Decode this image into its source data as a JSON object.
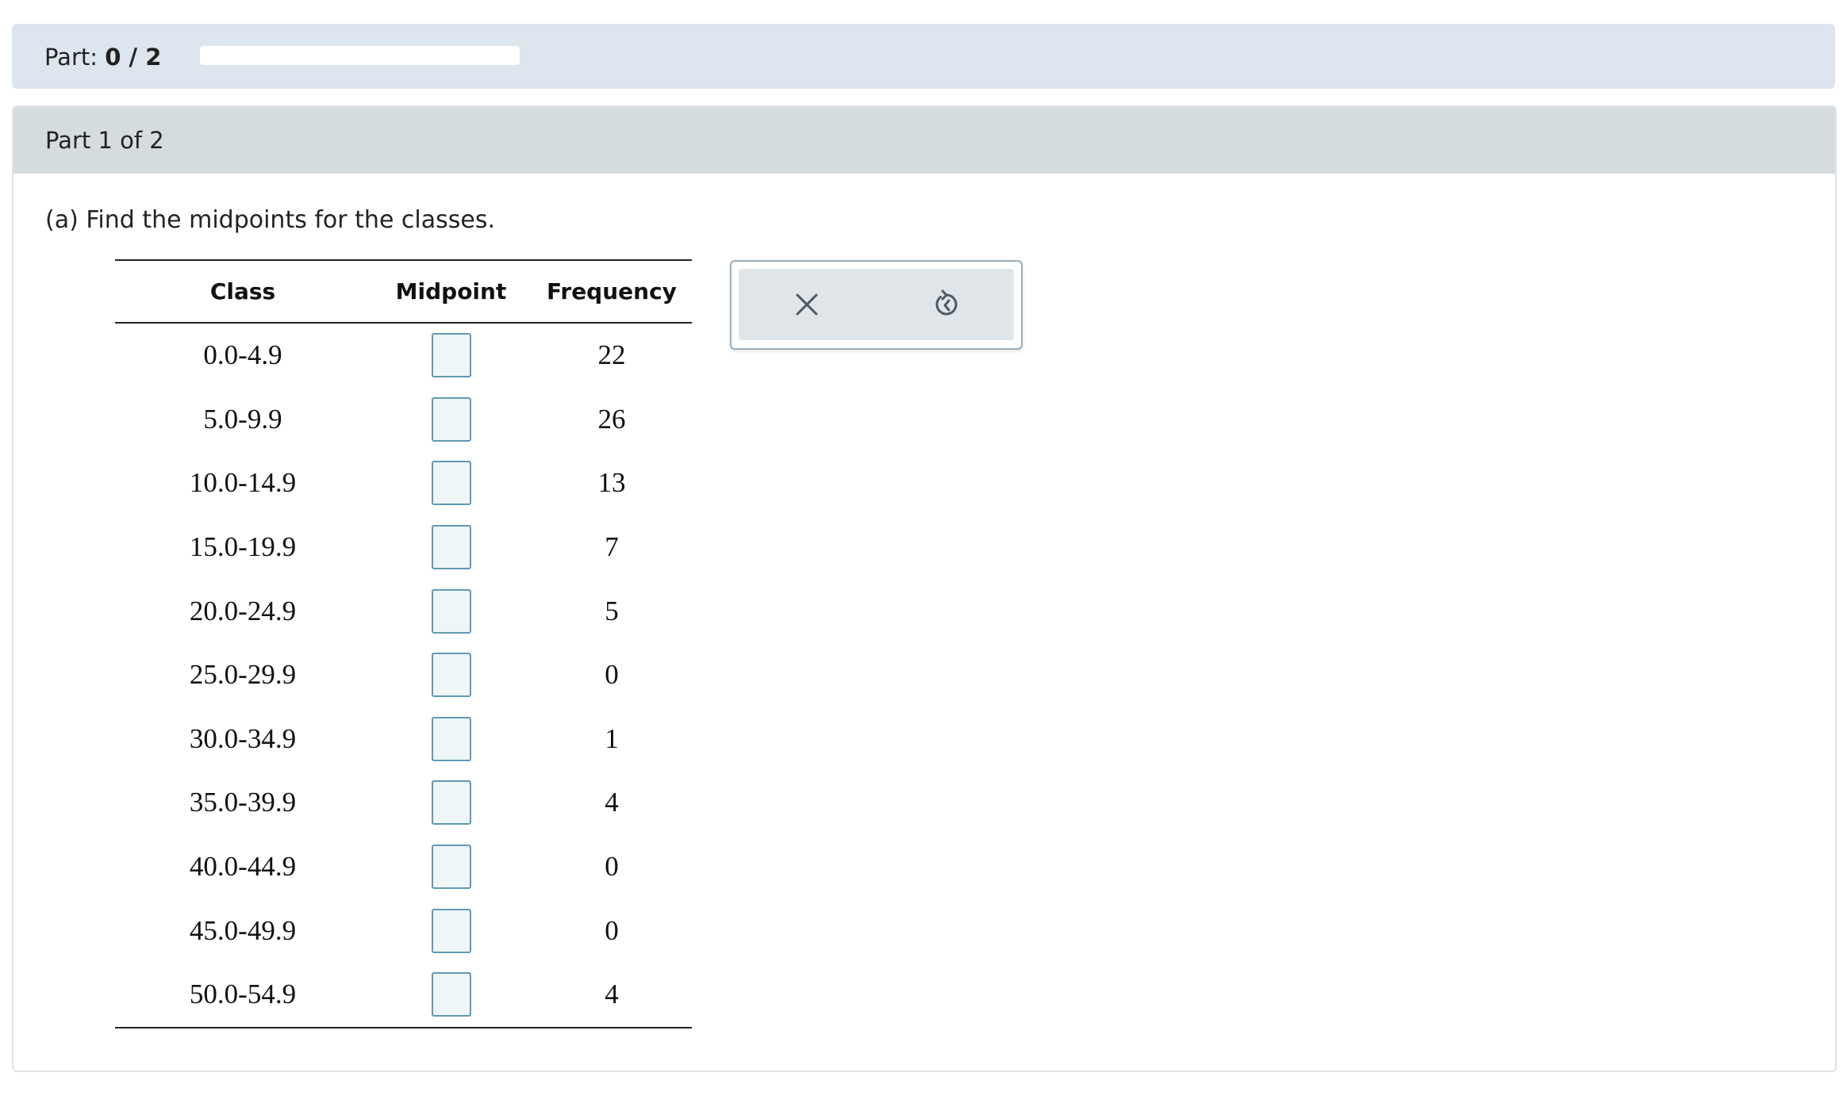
{
  "progress": {
    "label": "Part:",
    "value_text": "0 / 2",
    "fraction_complete": 0.0
  },
  "part": {
    "title": "Part 1 of 2",
    "question": "(a) Find the midpoints for the classes."
  },
  "table": {
    "headers": {
      "class": "Class",
      "midpoint": "Midpoint",
      "frequency": "Frequency"
    },
    "rows": [
      {
        "class": "0.0-4.9",
        "midpoint": "",
        "frequency": "22"
      },
      {
        "class": "5.0-9.9",
        "midpoint": "",
        "frequency": "26"
      },
      {
        "class": "10.0-14.9",
        "midpoint": "",
        "frequency": "13"
      },
      {
        "class": "15.0-19.9",
        "midpoint": "",
        "frequency": "7"
      },
      {
        "class": "20.0-24.9",
        "midpoint": "",
        "frequency": "5"
      },
      {
        "class": "25.0-29.9",
        "midpoint": "",
        "frequency": "0"
      },
      {
        "class": "30.0-34.9",
        "midpoint": "",
        "frequency": "1"
      },
      {
        "class": "35.0-39.9",
        "midpoint": "",
        "frequency": "4"
      },
      {
        "class": "40.0-44.9",
        "midpoint": "",
        "frequency": "0"
      },
      {
        "class": "45.0-49.9",
        "midpoint": "",
        "frequency": "0"
      },
      {
        "class": "50.0-54.9",
        "midpoint": "",
        "frequency": "4"
      }
    ]
  },
  "toolbar": {
    "clear_icon": "close-icon",
    "undo_icon": "undo-icon"
  },
  "colors": {
    "progress_panel_bg": "#dde6ee",
    "part_header_bg": "#d5dcdf",
    "answer_box_border": "#5f9ab3",
    "answer_box_bg": "#eef6f8",
    "tool_icon": "#4a5b66"
  }
}
